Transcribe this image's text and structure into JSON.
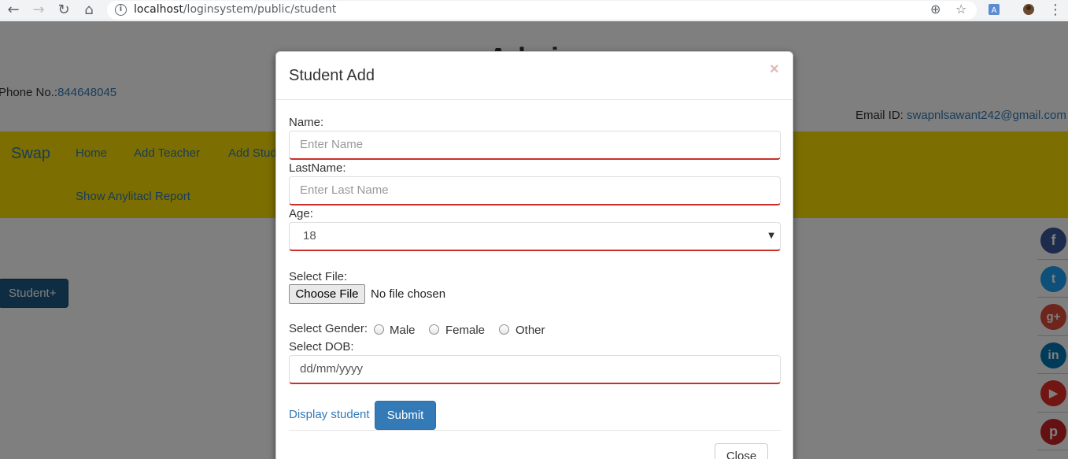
{
  "browser": {
    "url_host": "localhost",
    "url_path": "/loginsystem/public/student"
  },
  "page": {
    "title": "Admin",
    "phone_label": "Phone No.:",
    "phone_value": "844648045",
    "email_label": "Email ID: ",
    "email_value": "swapnlsawant242@gmail.com",
    "brand": "Swap",
    "nav": [
      "Home",
      "Add Teacher",
      "Add Student",
      "Show Anylitacl Report"
    ],
    "student_button": "Student+"
  },
  "social": [
    "facebook",
    "twitter",
    "google-plus",
    "linkedin",
    "youtube",
    "pinterest"
  ],
  "colors": {
    "navbar": "#f9dd03",
    "primary": "#337ab7",
    "danger_border": "#c9302c",
    "facebook": "#3b5998",
    "twitter": "#1da1f2",
    "google": "#dd4b39",
    "linkedin": "#0077b5",
    "youtube": "#e52d27",
    "pinterest": "#cb2027"
  },
  "modal": {
    "title": "Student Add",
    "close_x": "×",
    "name_label": "Name:",
    "name_placeholder": "Enter Name",
    "lastname_label": "LastName:",
    "lastname_placeholder": "Enter Last Name",
    "age_label": "Age:",
    "age_value": "18",
    "file_label": "Select File:",
    "file_button": "Choose File",
    "file_status": "No file chosen",
    "gender_label": "Select Gender:",
    "gender_options": [
      "Male",
      "Female",
      "Other"
    ],
    "dob_label": "Select DOB:",
    "dob_placeholder": "dd/mm/yyyy",
    "display_link": "Display student",
    "submit": "Submit",
    "close": "Close"
  }
}
